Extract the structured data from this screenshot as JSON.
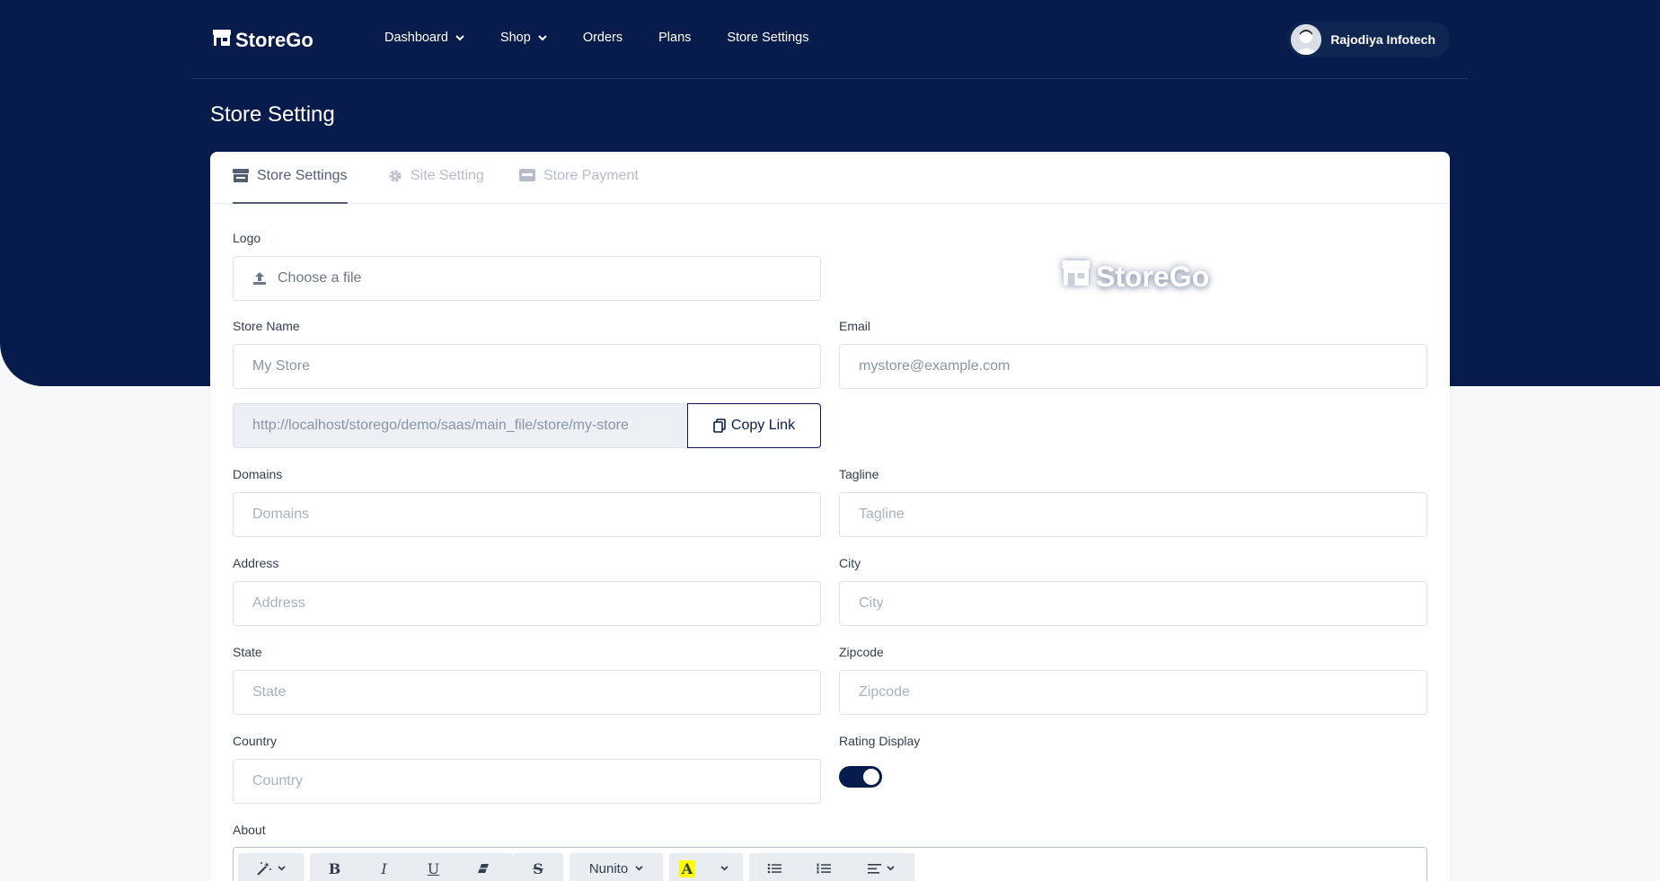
{
  "brand": {
    "name": "StoreGo"
  },
  "nav": {
    "items": [
      {
        "label": "Dashboard",
        "has_dropdown": true
      },
      {
        "label": "Shop",
        "has_dropdown": true
      },
      {
        "label": "Orders",
        "has_dropdown": false
      },
      {
        "label": "Plans",
        "has_dropdown": false
      },
      {
        "label": "Store Settings",
        "has_dropdown": false
      }
    ],
    "user": {
      "name": "Rajodiya Infotech"
    }
  },
  "page": {
    "title": "Store Setting"
  },
  "tabs": [
    {
      "label": "Store Settings",
      "icon": "store-icon",
      "active": true
    },
    {
      "label": "Site Setting",
      "icon": "gear-icon",
      "active": false
    },
    {
      "label": "Store Payment",
      "icon": "credit-card-icon",
      "active": false
    }
  ],
  "form": {
    "logo": {
      "label": "Logo",
      "placeholder": "Choose a file",
      "preview_text": "StoreGo"
    },
    "store_name": {
      "label": "Store Name",
      "value": "My Store"
    },
    "email": {
      "label": "Email",
      "value": "mystore@example.com"
    },
    "store_link": {
      "value": "http://localhost/storego/demo/saas/main_file/store/my-store",
      "button": "Copy Link"
    },
    "domains": {
      "label": "Domains",
      "placeholder": "Domains"
    },
    "tagline": {
      "label": "Tagline",
      "placeholder": "Tagline"
    },
    "address": {
      "label": "Address",
      "placeholder": "Address"
    },
    "city": {
      "label": "City",
      "placeholder": "City"
    },
    "state": {
      "label": "State",
      "placeholder": "State"
    },
    "zipcode": {
      "label": "Zipcode",
      "placeholder": "Zipcode"
    },
    "country": {
      "label": "Country",
      "placeholder": "Country"
    },
    "rating_display": {
      "label": "Rating Display",
      "enabled": true
    },
    "about": {
      "label": "About"
    }
  },
  "editor_toolbar": {
    "font_name": "Nunito",
    "highlight_color": "#ffff00"
  },
  "colors": {
    "navy": "#081c4b",
    "page_bg": "#f7f8fa",
    "muted_tab": "#b6bdc9"
  }
}
